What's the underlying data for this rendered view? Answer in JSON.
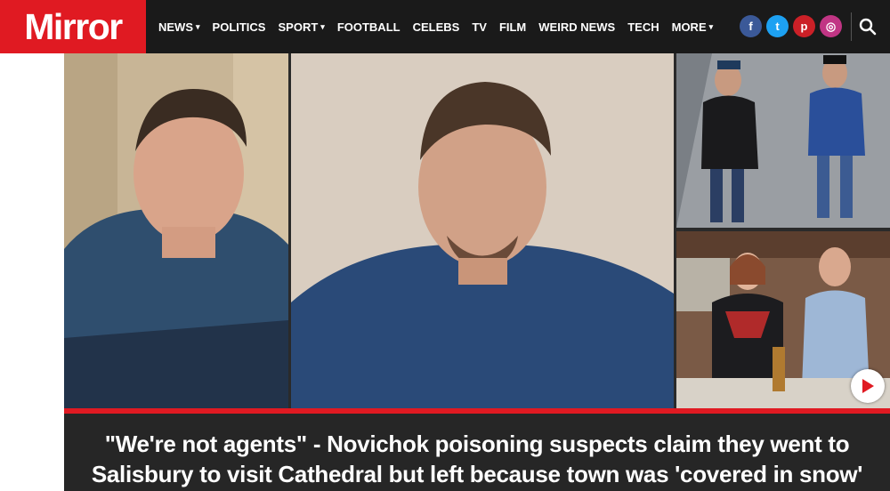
{
  "brand": {
    "name": "Mirror",
    "color": "#e01a22"
  },
  "nav": {
    "items": [
      {
        "label": "NEWS",
        "dropdown": true
      },
      {
        "label": "POLITICS",
        "dropdown": false
      },
      {
        "label": "SPORT",
        "dropdown": true
      },
      {
        "label": "FOOTBALL",
        "dropdown": false
      },
      {
        "label": "CELEBS",
        "dropdown": false
      },
      {
        "label": "TV",
        "dropdown": false
      },
      {
        "label": "FILM",
        "dropdown": false
      },
      {
        "label": "WEIRD NEWS",
        "dropdown": false
      },
      {
        "label": "TECH",
        "dropdown": false
      },
      {
        "label": "MORE",
        "dropdown": true
      }
    ],
    "caret": "▾"
  },
  "social": [
    {
      "icon": "facebook-icon",
      "glyph": "f",
      "color": "#3b5998"
    },
    {
      "icon": "twitter-icon",
      "glyph": "t",
      "color": "#1da1f2"
    },
    {
      "icon": "pinterest-icon",
      "glyph": "p",
      "color": "#cb2027"
    },
    {
      "icon": "instagram-icon",
      "glyph": "◎",
      "color": "#c13584"
    }
  ],
  "search": {
    "icon": "search-icon"
  },
  "hero": {
    "images": [
      "suspect-portrait-left",
      "suspect-portrait-center",
      "cctv-street-photo",
      "restaurant-photo"
    ],
    "play_icon": "play-icon"
  },
  "headline": {
    "line1": "\"We're not agents\" - Novichok poisoning suspects claim they went to",
    "line2": "Salisbury to visit Cathedral but left because town was 'covered in snow'"
  }
}
